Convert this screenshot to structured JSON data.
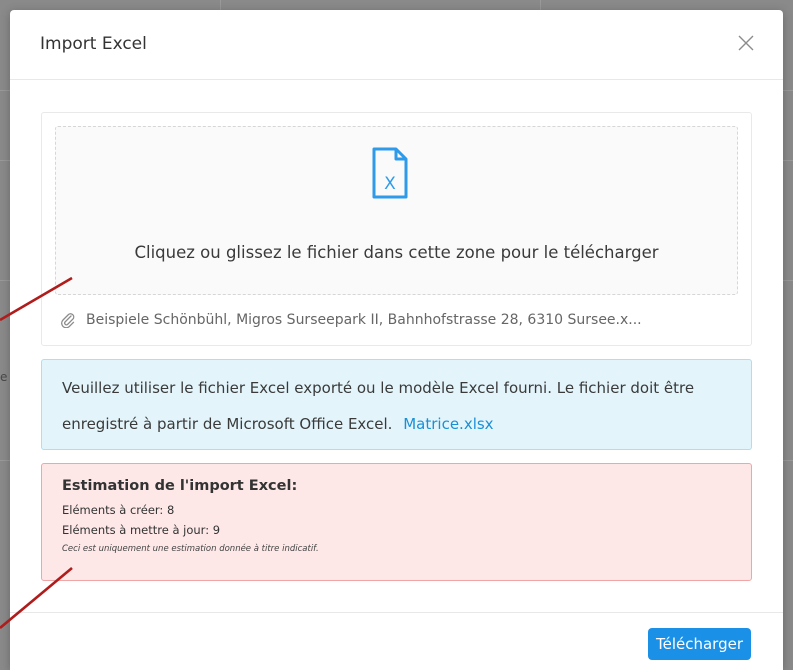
{
  "background": {
    "side_text": "e"
  },
  "modal": {
    "title": "Import Excel"
  },
  "upload": {
    "drop_text": "Cliquez ou glissez le fichier dans cette zone pour le télécharger",
    "file_icon_letter": "X",
    "file_name": "Beispiele Schönbühl, Migros Surseepark II, Bahnhofstrasse 28, 6310 Sursee.x..."
  },
  "info": {
    "text": "Veuillez utiliser le fichier Excel exporté ou le modèle Excel fourni. Le fichier doit être enregistré à partir de Microsoft Office Excel.",
    "link": "Matrice.xlsx"
  },
  "estimate": {
    "title": "Estimation de l'import Excel:",
    "create_line": "Eléments à créer: 8",
    "update_line": "Eléments à mettre à jour: 9",
    "note": "Ceci est uniquement une estimation donnée à titre indicatif."
  },
  "footer": {
    "primary_label": "Télécharger"
  },
  "colors": {
    "primary": "#1a90e6",
    "info_bg": "#e3f5fb",
    "warn_bg": "#fde7e7",
    "annotation": "#b01c1c"
  },
  "icons": {
    "close": "close-icon",
    "file": "excel-file-icon",
    "attachment": "paperclip-icon"
  }
}
